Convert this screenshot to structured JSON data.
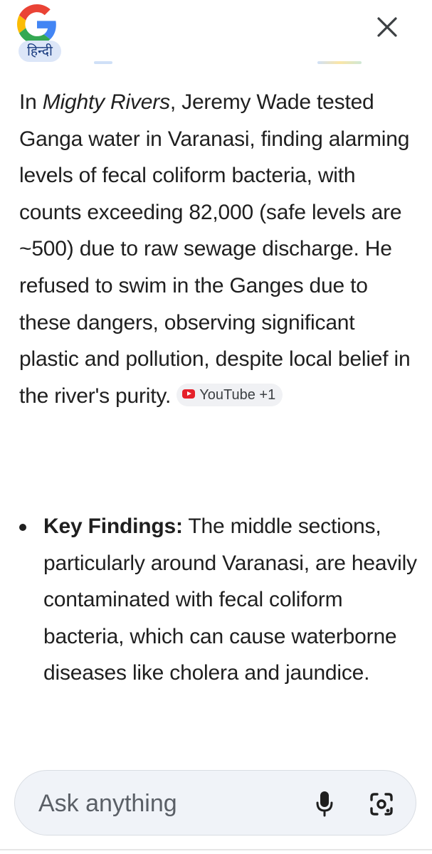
{
  "header": {
    "language_chip": "हिन्दी"
  },
  "answer": {
    "prefix": "In ",
    "title_italic": "Mighty Rivers",
    "body": ", Jeremy Wade tested Ganga water in Varanasi, finding alarming levels of fecal coliform bacteria, with counts exceeding 82,000 (safe levels are ~500) due to raw sewage discharge. He refused to swim in the Ganges due to these dangers, observing significant plastic and pollution, despite local belief in the river's purity. ",
    "source_label": "YouTube +1"
  },
  "findings": {
    "label": "Key Findings:",
    "text": " The middle sections, particularly around Varanasi, are heavily contaminated with fecal coliform bacteria, which can cause waterborne diseases like cholera and jaundice."
  },
  "ask_bar": {
    "placeholder": "Ask anything"
  },
  "colors": {
    "google_blue": "#4285F4",
    "google_red": "#EA4335",
    "google_yellow": "#FBBC05",
    "google_green": "#34A853",
    "youtube_red": "#e5202a"
  }
}
